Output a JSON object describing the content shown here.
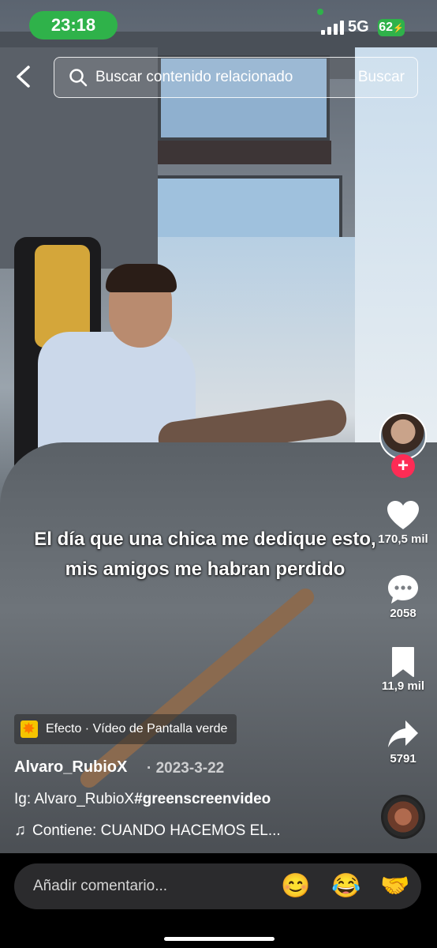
{
  "status_bar": {
    "time": "23:18",
    "network": "5G",
    "battery": "62"
  },
  "search": {
    "placeholder": "Buscar contenido relacionado",
    "button": "Buscar"
  },
  "video": {
    "caption": "El día que una chica me dedique esto, mis amigos me habran perdido"
  },
  "actions": {
    "likes": "170,5 mil",
    "comments": "2058",
    "saves": "11,9 mil",
    "shares": "5791",
    "follow_symbol": "+"
  },
  "post": {
    "effect_label": "Efecto · Vídeo de Pantalla verde",
    "username": "Alvaro_RubioX",
    "date": "· 2023-3-22",
    "description_prefix": "Ig: Alvaro_RubioX",
    "hashtag": "#greenscreenvideo",
    "music": "Contiene: CUANDO HACEMOS EL..."
  },
  "comment": {
    "placeholder": "Añadir comentario...",
    "emojis": [
      "😊",
      "😂",
      "🤝"
    ]
  },
  "colors": {
    "accent": "#fe2c55",
    "status_green": "#2fb24a",
    "effect_yellow": "#f5c400"
  }
}
